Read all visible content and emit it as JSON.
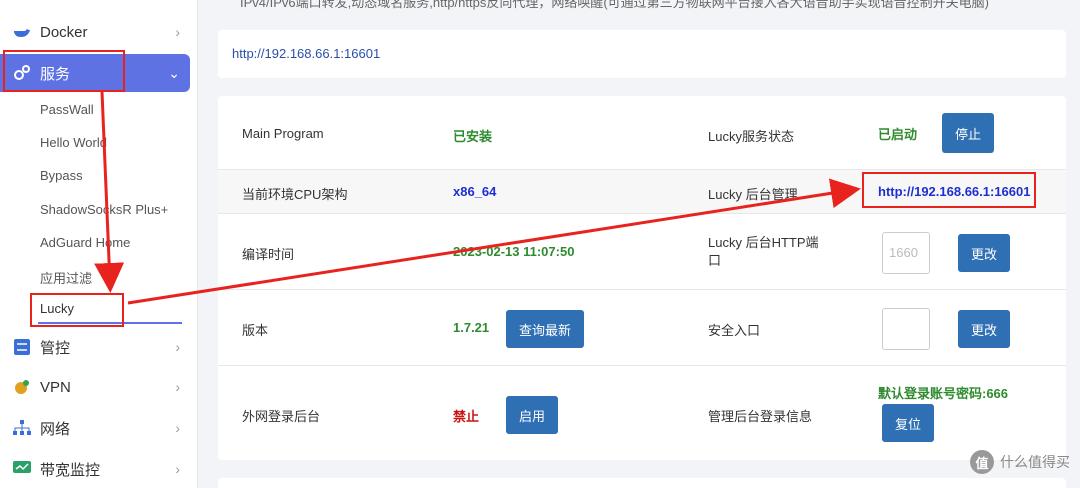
{
  "sidebar": {
    "docker": "Docker",
    "services": "服务",
    "subitems": [
      "PassWall",
      "Hello World",
      "Bypass",
      "ShadowSocksR Plus+",
      "AdGuard Home",
      "应用过滤",
      "Lucky"
    ],
    "control": "管控",
    "vpn": "VPN",
    "network": "网络",
    "bandwidth": "带宽监控"
  },
  "top_note": "IPv4/IPv6端口转发,动态域名服务,http/https反向代理，网络唤醒(可通过第三方物联网平台接入各大语音助手实现语音控制开关电脑)",
  "url_card": {
    "url": "http://192.168.66.1:16601"
  },
  "table": {
    "main_program_label": "Main Program",
    "main_program_value": "已安装",
    "lucky_status_label": "Lucky服务状态",
    "lucky_status_value": "已启动",
    "stop_button": "停止",
    "cpu_label": "当前环境CPU架构",
    "cpu_value": "x86_64",
    "admin_label": "Lucky 后台管理",
    "admin_url": "http://192.168.66.1:16601",
    "compile_label": "编译时间",
    "compile_value": "2023-02-13 11:07:50",
    "http_port_label": "Lucky 后台HTTP端口",
    "http_port_value": "1660",
    "change_button": "更改",
    "version_label": "版本",
    "version_value": "1.7.21",
    "check_latest_button": "查询最新",
    "security_label": "安全入口",
    "change_button_2": "更改",
    "wan_login_label": "外网登录后台",
    "wan_login_value": "禁止",
    "enable_button": "启用",
    "mgmt_login_label": "管理后台登录信息",
    "default_login": "默认登录账号密码:666",
    "reset_button": "复位"
  },
  "watermark": {
    "badge": "值",
    "text": "什么值得买"
  },
  "colors": {
    "accent": "#5e72e4",
    "button": "#2f6fb3",
    "annotation": "#e8231e",
    "green": "#2e8b2e",
    "link": "#1d2fd0"
  }
}
